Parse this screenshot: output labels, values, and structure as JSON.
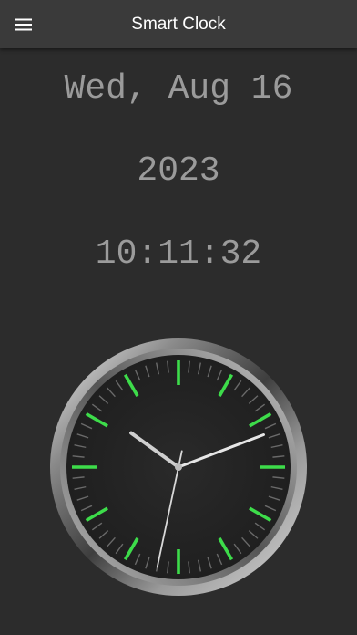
{
  "app": {
    "title": "Smart Clock",
    "menu_icon": "hamburger-menu-icon"
  },
  "display": {
    "date": "Wed, Aug 16",
    "year": "2023",
    "time": "10:11:32"
  },
  "analog_clock": {
    "hour": 10,
    "minute": 11,
    "second": 32
  },
  "colors": {
    "background": "#2c2c2c",
    "topbar": "#3a3a3a",
    "text": "#9b9b9b",
    "accent_green": "#3ddc4a"
  }
}
